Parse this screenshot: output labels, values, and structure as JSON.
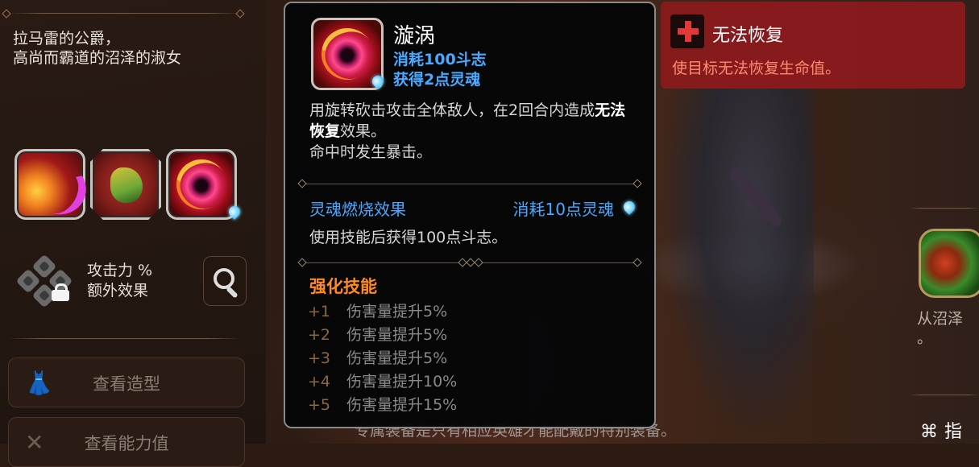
{
  "left_panel": {
    "description": "拉马雷的公爵，\n高尚而霸道的沼泽的淑女",
    "attack_label_line1": "攻击力 %",
    "attack_label_line2": "额外效果",
    "buttons": [
      {
        "label": "查看造型",
        "icon": "dress-icon"
      },
      {
        "label": "查看能力值",
        "icon": "crossed-swords-icon"
      }
    ]
  },
  "skill_tooltip": {
    "name": "漩涡",
    "cost": "消耗100斗志",
    "gain": "获得2点灵魂",
    "desc_part1": "用旋转砍击攻击全体敌人，在2回合内造成",
    "desc_highlight": "无法恢复",
    "desc_part2": "效果。",
    "desc_line3": "命中时发生暴击。",
    "soul_burn_title": "灵魂燃烧效果",
    "soul_burn_cost": "消耗10点灵魂",
    "soul_burn_desc": "使用技能后获得100点斗志。",
    "enhance_title": "强化技能",
    "enhancements": [
      {
        "level": "+1",
        "text": "伤害量提升5%"
      },
      {
        "level": "+2",
        "text": "伤害量提升5%"
      },
      {
        "level": "+3",
        "text": "伤害量提升5%"
      },
      {
        "level": "+4",
        "text": "伤害量提升10%"
      },
      {
        "level": "+5",
        "text": "伤害量提升15%"
      }
    ]
  },
  "status_tooltip": {
    "title": "无法恢复",
    "desc": "使目标无法恢复生命值。"
  },
  "right_side": {
    "frag_text_line1": "从沼泽",
    "frag_text_line2": "。",
    "guide_label": "指"
  },
  "bottom_text": "专属装备是只有相应英雄才能配戴的特别装备。"
}
